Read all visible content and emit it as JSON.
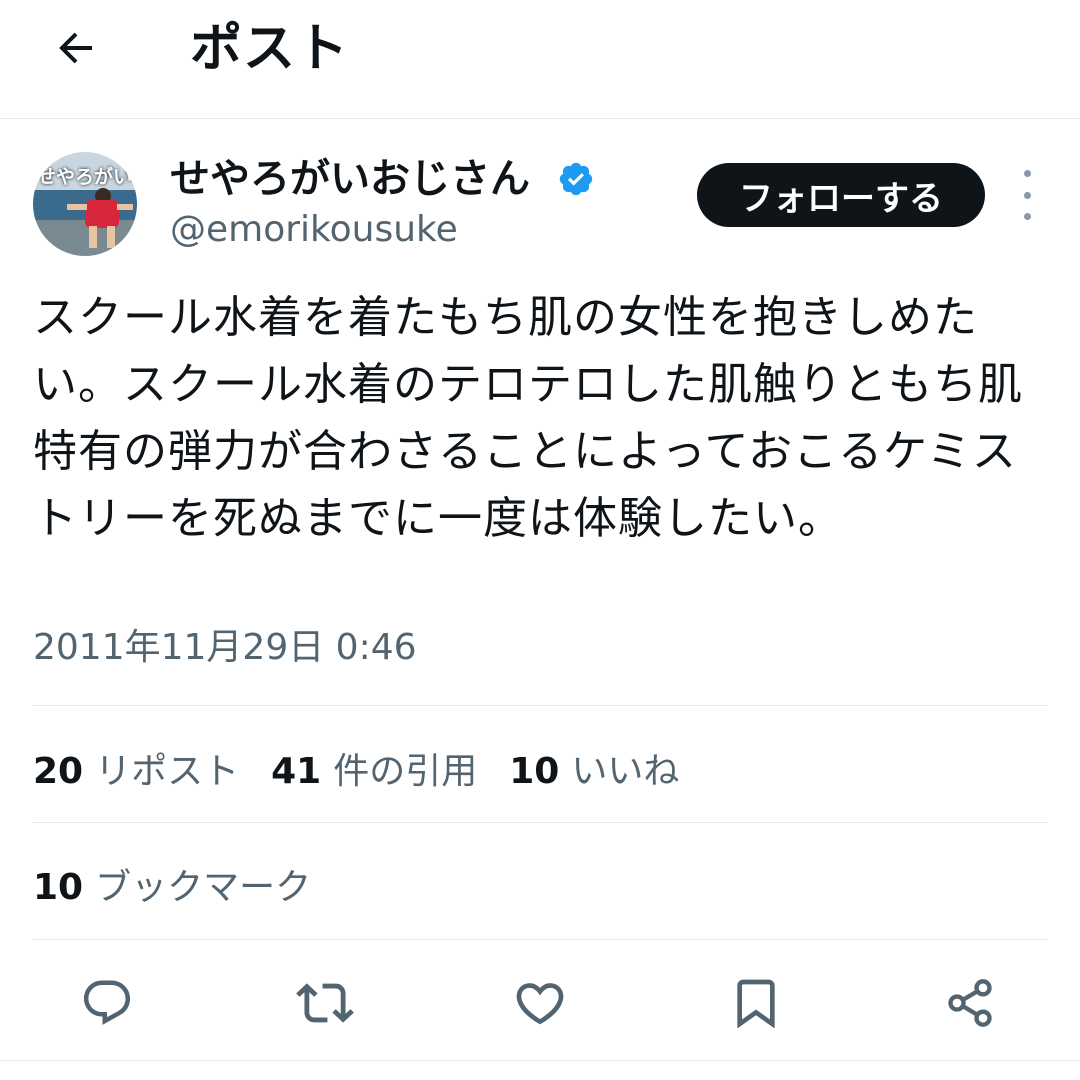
{
  "header": {
    "title": "ポスト",
    "back_icon": "arrow-left-icon"
  },
  "author": {
    "avatar_text": "せやろがい",
    "display_name": "せやろがいおじさん",
    "handle": "@emorikousuke",
    "verified": true,
    "verified_color": "#1d9bf0"
  },
  "follow_button": {
    "label": "フォローする"
  },
  "tweet": {
    "text": "スクール水着を着たもち肌の女性を抱きしめたい。スクール水着のテロテロした肌触りともち肌特有の弾力が合わさることによっておこるケミストリーを死ぬまでに一度は体験したい。",
    "timestamp": "2011年11月29日 0:46"
  },
  "stats": {
    "reposts": {
      "count": "20",
      "label": "リポスト"
    },
    "quotes": {
      "count": "41",
      "label": "件の引用"
    },
    "likes": {
      "count": "10",
      "label": "いいね"
    },
    "bookmarks": {
      "count": "10",
      "label": "ブックマーク"
    }
  },
  "actions": [
    "reply-icon",
    "repost-icon",
    "like-icon",
    "bookmark-icon",
    "share-icon"
  ],
  "colors": {
    "text_primary": "#0f1419",
    "text_secondary": "#536471",
    "divider": "#e6e8ea",
    "button_bg": "#0f1419",
    "accent": "#1d9bf0"
  }
}
